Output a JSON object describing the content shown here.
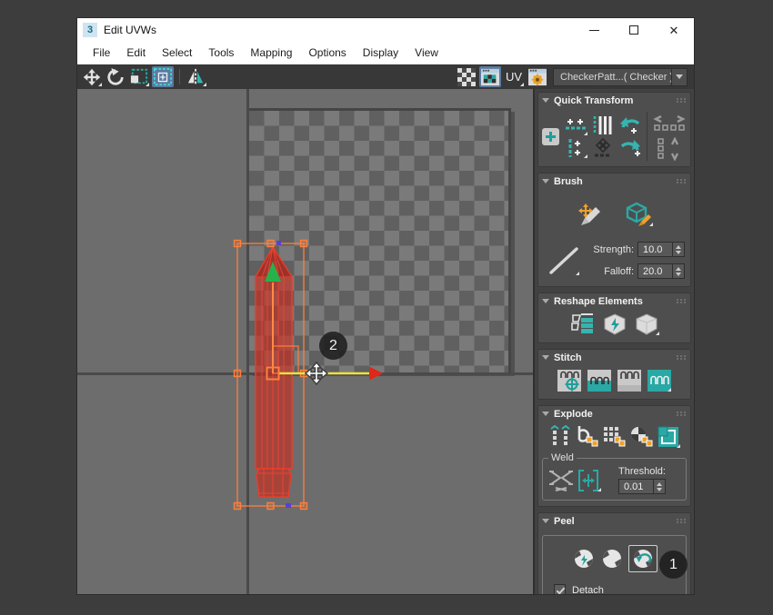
{
  "window": {
    "app_icon": "3",
    "title": "Edit UVWs",
    "controls": {
      "close": "✕"
    }
  },
  "menu": {
    "items": [
      "File",
      "Edit",
      "Select",
      "Tools",
      "Mapping",
      "Options",
      "Display",
      "View"
    ]
  },
  "toolbar": {
    "uv_label": "UV",
    "texture_dropdown_value": "CheckerPatt...( Checker )"
  },
  "canvas": {
    "move_badge": "2"
  },
  "panel": {
    "quick_transform": {
      "title": "Quick Transform"
    },
    "brush": {
      "title": "Brush",
      "strength_label": "Strength:",
      "strength_value": "10.0",
      "falloff_label": "Falloff:",
      "falloff_value": "20.0"
    },
    "reshape": {
      "title": "Reshape Elements"
    },
    "stitch": {
      "title": "Stitch"
    },
    "explode": {
      "title": "Explode",
      "weld_label": "Weld",
      "threshold_label": "Threshold:",
      "threshold_value": "0.01"
    },
    "peel": {
      "title": "Peel",
      "detach_label": "Detach",
      "badge": "1"
    }
  },
  "colors": {
    "accent_teal": "#2aa8a5",
    "accent_orange": "#f0a028",
    "gizmo_orange": "#ff7f3c",
    "axis_yellow": "#ece23e",
    "axis_red": "#df2817",
    "axis_green": "#27b24b",
    "selection_red": "#e63e2a",
    "active_button_blue": "#5a7aa0"
  }
}
